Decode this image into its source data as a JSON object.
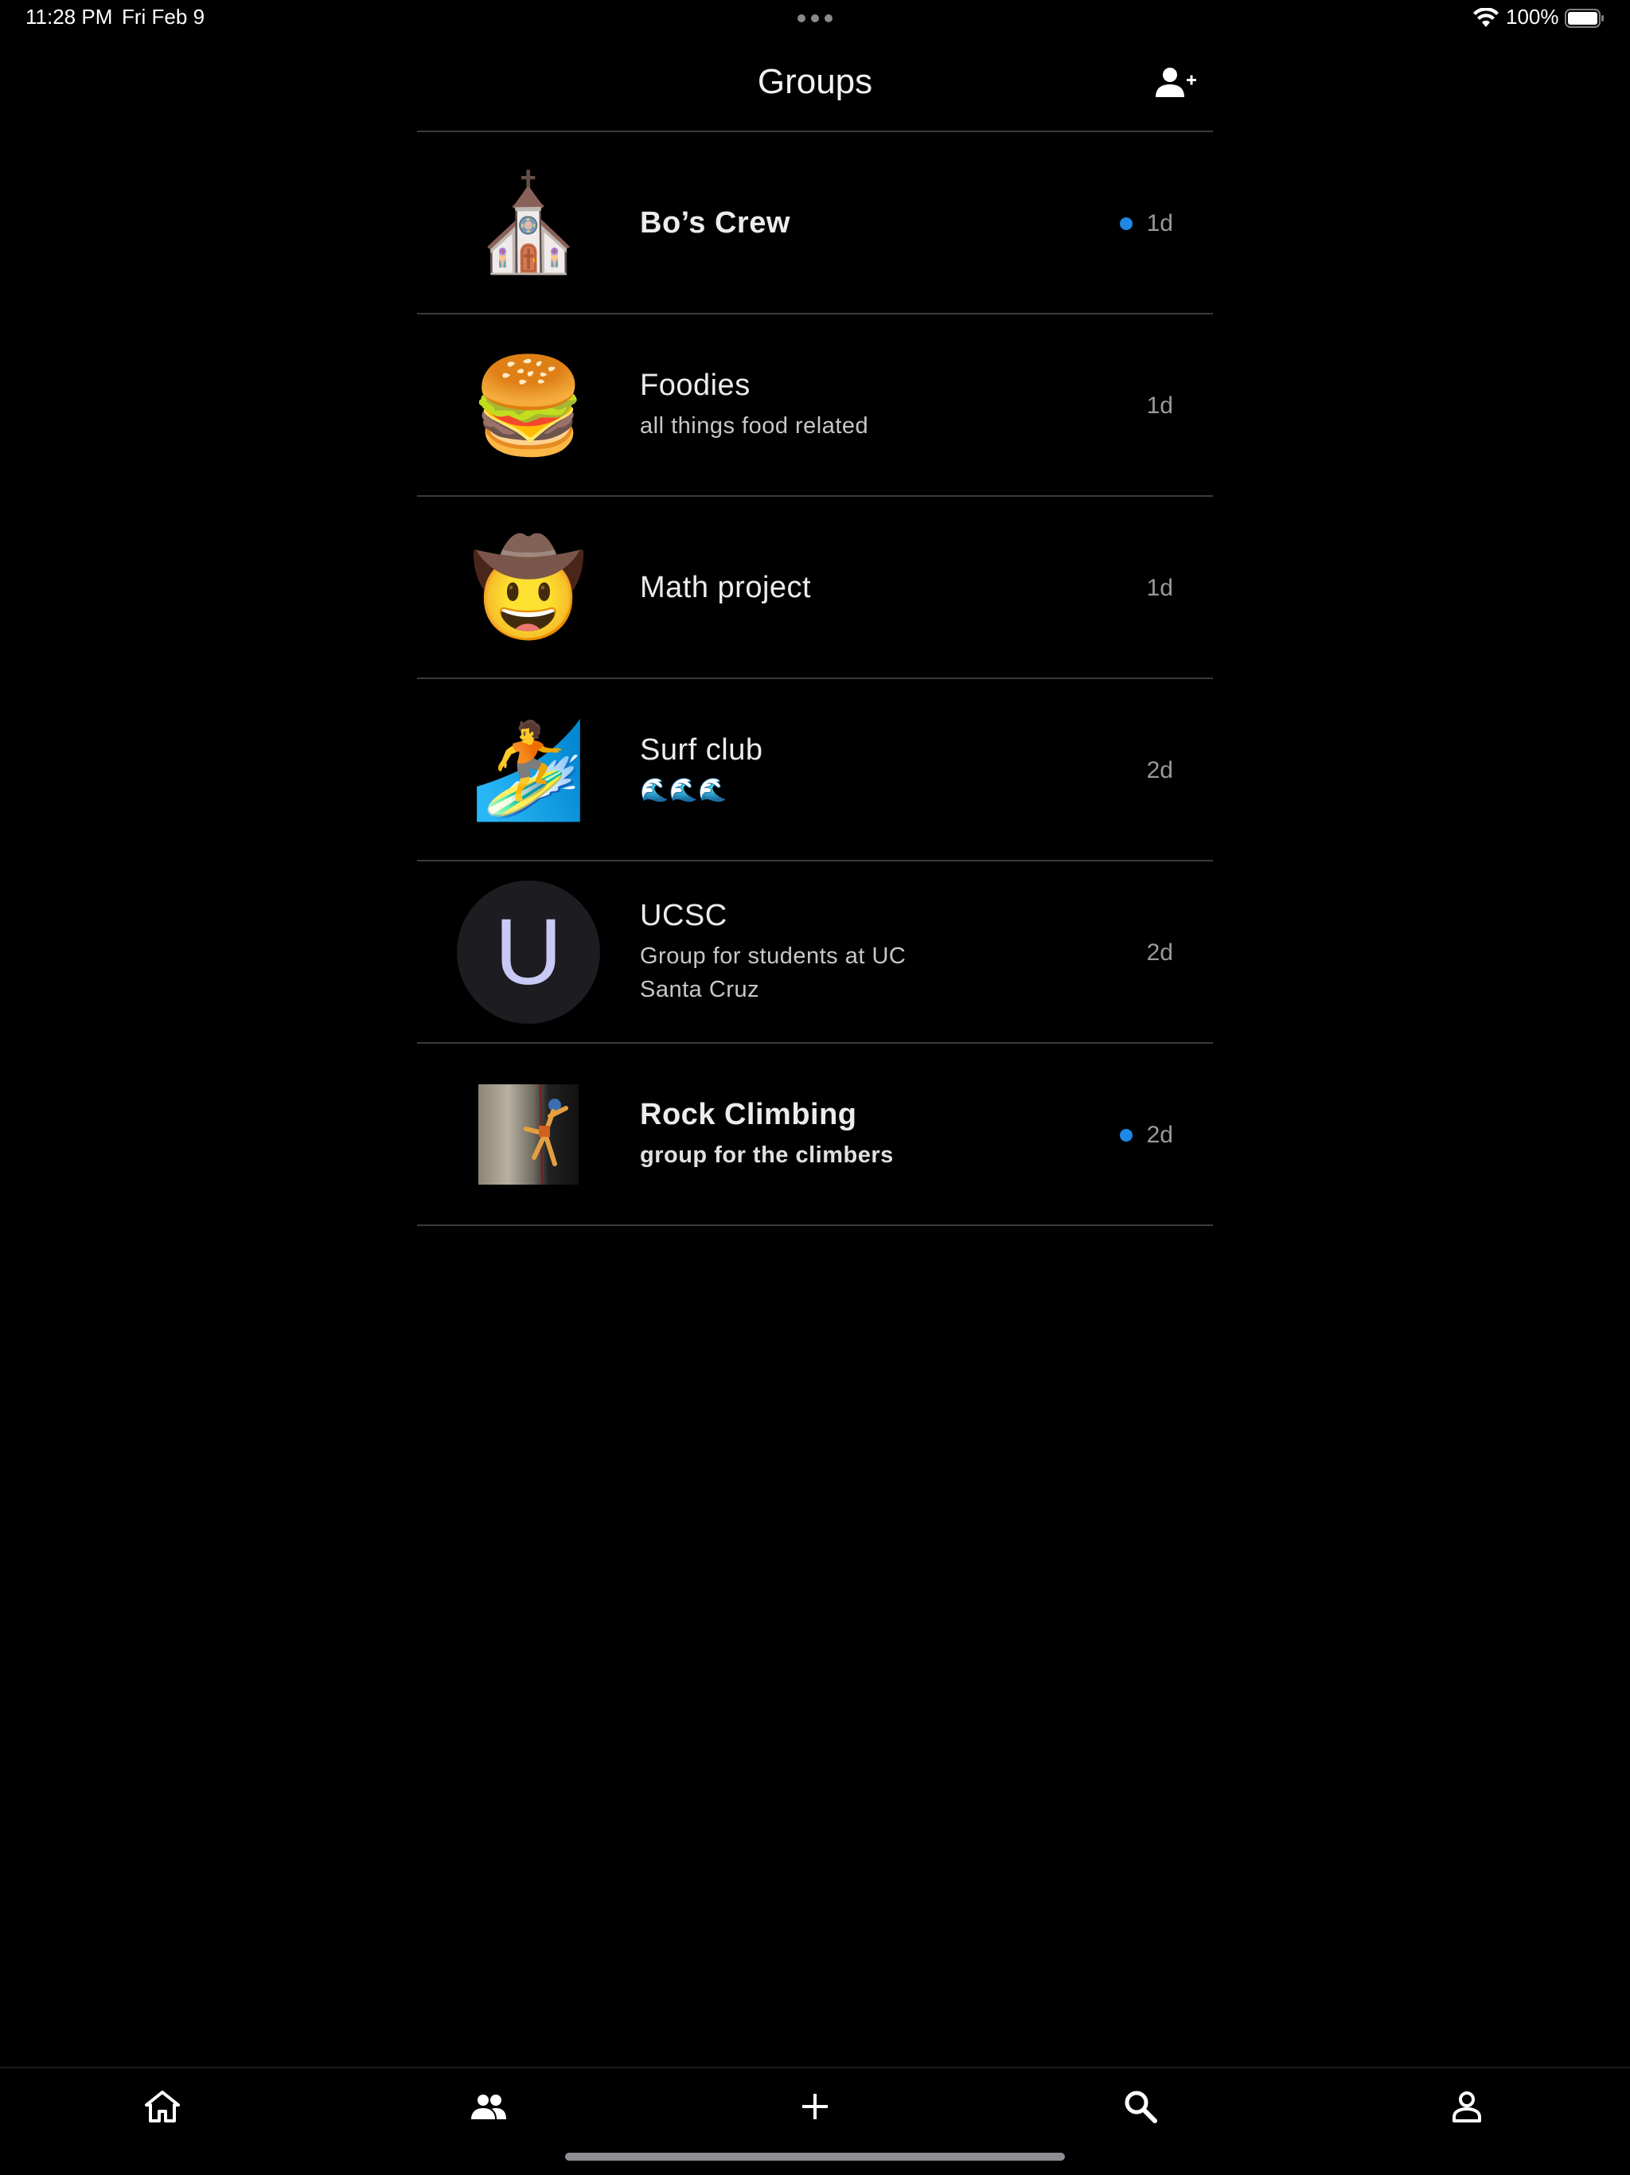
{
  "status_bar": {
    "time": "11:28 PM",
    "date": "Fri Feb 9",
    "battery": "100%"
  },
  "header": {
    "title": "Groups",
    "add_icon": "add-person-icon"
  },
  "groups": [
    {
      "name": "Bo’s Crew",
      "subtitle": "",
      "time": "1d",
      "unread": true,
      "avatar_type": "emoji",
      "avatar": "⛪"
    },
    {
      "name": "Foodies",
      "subtitle": "all things food related",
      "time": "1d",
      "unread": false,
      "avatar_type": "emoji",
      "avatar": "🍔"
    },
    {
      "name": "Math project",
      "subtitle": "",
      "time": "1d",
      "unread": false,
      "avatar_type": "emoji",
      "avatar": "🤠"
    },
    {
      "name": "Surf club",
      "subtitle": "🌊🌊🌊",
      "time": "2d",
      "unread": false,
      "avatar_type": "emoji",
      "avatar": "🏄"
    },
    {
      "name": "UCSC",
      "subtitle": "Group for students at UC Santa Cruz",
      "time": "2d",
      "unread": false,
      "avatar_type": "letter",
      "avatar": "U"
    },
    {
      "name": "Rock Climbing",
      "subtitle": "group for the climbers",
      "time": "2d",
      "unread": true,
      "avatar_type": "photo",
      "avatar": "rock-climbing-photo"
    }
  ],
  "tabbar": {
    "items": [
      "home-icon",
      "groups-icon",
      "plus-icon",
      "search-icon",
      "profile-icon"
    ]
  },
  "colors": {
    "background": "#000000",
    "unread_dot": "#1e88e5",
    "divider": "#3a3a3c"
  }
}
